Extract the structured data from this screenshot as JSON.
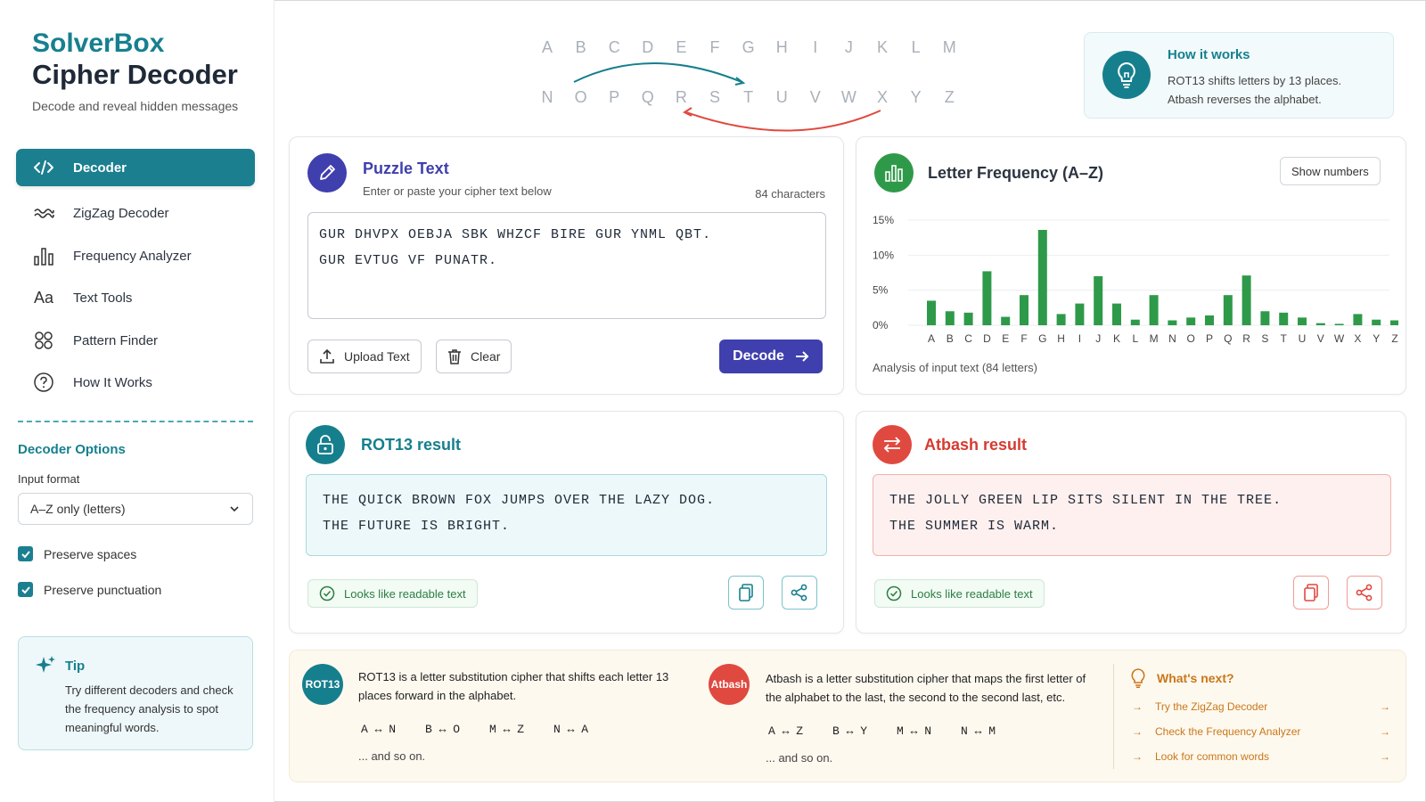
{
  "brand": {
    "name": "SolverBox",
    "title": "Cipher Decoder",
    "subtitle": "Decode and reveal hidden messages"
  },
  "sidebar": {
    "items": [
      {
        "label": "Decoder",
        "icon": "code-icon",
        "active": true
      },
      {
        "label": "ZigZag Decoder",
        "icon": "wave-icon"
      },
      {
        "label": "Frequency Analyzer",
        "icon": "bar-chart-icon"
      },
      {
        "label": "Text Tools",
        "icon": "text-icon"
      },
      {
        "label": "Pattern Finder",
        "icon": "grid-circles-icon"
      },
      {
        "label": "How It Works",
        "icon": "help-circle-icon"
      }
    ]
  },
  "options": {
    "title": "Decoder Options",
    "input_format_label": "Input format",
    "input_format_value": "A–Z only (letters)",
    "preserve_spaces": "Preserve spaces",
    "preserve_punctuation": "Preserve punctuation"
  },
  "tip": {
    "title": "Tip",
    "text": "Try different decoders and check the frequency analysis to spot meaningful words."
  },
  "alphabet": {
    "top": [
      "A",
      "B",
      "C",
      "D",
      "E",
      "F",
      "G",
      "H",
      "I",
      "J",
      "K",
      "L",
      "M"
    ],
    "bottom": [
      "N",
      "O",
      "P",
      "Q",
      "R",
      "S",
      "T",
      "U",
      "V",
      "W",
      "X",
      "Y",
      "Z"
    ]
  },
  "how": {
    "title": "How it works",
    "line1": "ROT13 shifts letters by 13 places.",
    "line2": "Atbash reverses the alphabet."
  },
  "puzzle": {
    "title": "Puzzle Text",
    "subtitle": "Enter or paste your cipher text below",
    "count": "84 characters",
    "text": "GUR DHVPX OEBJA SBK WHZCF BIRE GUR YNML QBT.\nGUR EVTUG VF PUNATR.",
    "upload_label": "Upload Text",
    "clear_label": "Clear",
    "decode_label": "Decode"
  },
  "frequency": {
    "title": "Letter Frequency (A–Z)",
    "show_numbers": "Show numbers",
    "caption": "Analysis of input text (84 letters)"
  },
  "chart_data": {
    "type": "bar",
    "categories": [
      "A",
      "B",
      "C",
      "D",
      "E",
      "F",
      "G",
      "H",
      "I",
      "J",
      "K",
      "L",
      "M",
      "N",
      "O",
      "P",
      "Q",
      "R",
      "S",
      "T",
      "U",
      "V",
      "W",
      "X",
      "Y",
      "Z"
    ],
    "values": [
      3.5,
      2.0,
      1.8,
      7.7,
      1.2,
      4.3,
      13.6,
      1.6,
      3.1,
      7.0,
      3.1,
      0.8,
      4.3,
      0.7,
      1.1,
      1.4,
      4.3,
      7.1,
      2.0,
      1.8,
      1.1,
      0.3,
      0.2,
      1.6,
      0.8,
      0.7
    ],
    "yticks": [
      "0%",
      "5%",
      "10%",
      "15%"
    ],
    "ylim": [
      0,
      15
    ],
    "grid": true,
    "color": "#2e9a49"
  },
  "rot13": {
    "title": "ROT13 result",
    "text": "THE QUICK BROWN FOX JUMPS OVER THE LAZY DOG.\nTHE FUTURE IS BRIGHT.",
    "badge": "Looks like readable text",
    "color": "#167f8d"
  },
  "atbash": {
    "title": "Atbash result",
    "text": "THE JOLLY GREEN LIP SITS SILENT IN THE TREE.\nTHE SUMMER IS WARM.",
    "badge": "Looks like readable text",
    "color": "#e0493f"
  },
  "info": {
    "rot13_label": "ROT13",
    "rot13_text": "ROT13 is a letter substitution cipher that shifts each letter 13 places forward in the alphabet.",
    "rot13_maps": [
      "A ↔ N",
      "B ↔ O",
      "M ↔ Z",
      "N ↔ A"
    ],
    "rot13_more": "... and so on.",
    "atbash_label": "Atbash",
    "atbash_text": "Atbash is a letter substitution cipher that maps the first letter of the alphabet to the last, the second to the second last, etc.",
    "atbash_maps": [
      "A ↔ Z",
      "B ↔ Y",
      "M ↔ N",
      "N ↔ M"
    ],
    "atbash_more": "... and so on.",
    "next_title": "What's next?",
    "next_items": [
      "Try the ZigZag Decoder",
      "Check the Frequency Analyzer",
      "Look for common words"
    ]
  }
}
